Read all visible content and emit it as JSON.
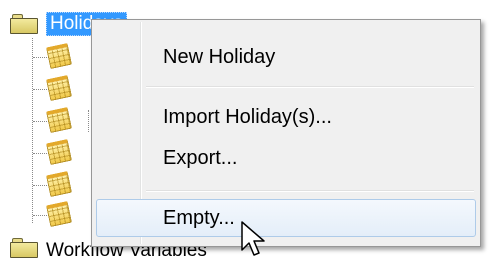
{
  "tree": {
    "root": {
      "label": "Holidays",
      "icon": "folder-icon",
      "selected": true
    },
    "children": [
      {
        "icon": "calendar-icon"
      },
      {
        "icon": "calendar-icon"
      },
      {
        "icon": "calendar-icon"
      },
      {
        "icon": "calendar-icon"
      },
      {
        "icon": "calendar-icon"
      },
      {
        "icon": "calendar-icon"
      }
    ],
    "next_sibling": {
      "label": "Workflow Variables",
      "icon": "folder-icon"
    }
  },
  "context_menu": {
    "items": [
      {
        "label": "New Holiday"
      },
      {
        "label": "Import Holiday(s)..."
      },
      {
        "label": "Export..."
      },
      {
        "label": "Empty...",
        "hovered": true
      }
    ]
  },
  "colors": {
    "selection": "#3399ff",
    "menu_background": "#f0f0f0",
    "hover_border": "#aecbe9"
  }
}
